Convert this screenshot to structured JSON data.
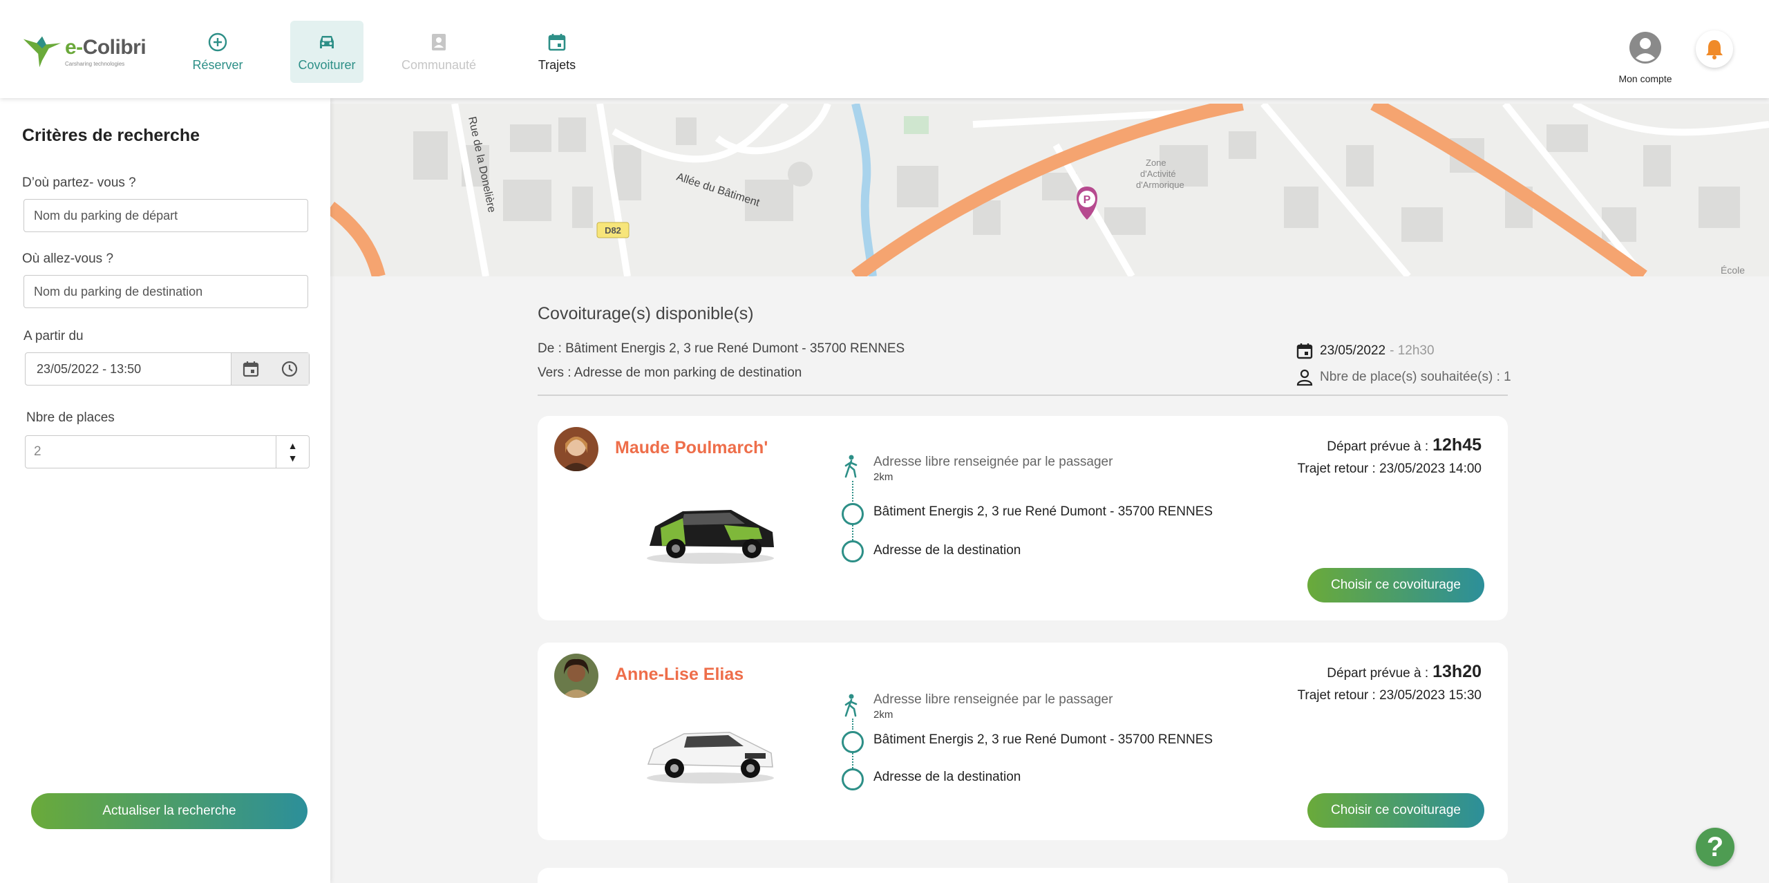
{
  "app": {
    "logo_name_prefix": "e-",
    "logo_name": "Colibri",
    "logo_tagline": "Carsharing technologies"
  },
  "nav": {
    "reserver": "Réserver",
    "covoiturer": "Covoiturer",
    "communaute": "Communauté",
    "trajets": "Trajets",
    "account": "Mon compte"
  },
  "sidebar": {
    "title": "Critères de recherche",
    "from_label": "D’où partez- vous ?",
    "from_placeholder": "Nom du parking de départ",
    "to_label": "Où allez-vous ?",
    "to_placeholder": "Nom du parking de destination",
    "date_label": "A partir du",
    "date_value": "23/05/2022  - 13:50",
    "seats_label": "Nbre de places",
    "seats_value": "2",
    "refresh_button": "Actualiser la recherche"
  },
  "map": {
    "street_1": "Rue de la Donelière",
    "street_2": "Allée du Bâtiment",
    "road_badge": "D82",
    "zone_label_1": "Zone",
    "zone_label_2": "d'Activité",
    "zone_label_3": "d'Armorique",
    "corner_label": "École",
    "parking_marker": "P"
  },
  "results": {
    "title": "Covoiturage(s) disponible(s)",
    "from": "De : Bâtiment Energis 2,  3 rue René Dumont - 35700 RENNES",
    "to": "Vers : Adresse de mon parking de destination",
    "date": "23/05/2022",
    "time": "- 12h30",
    "seats": "Nbre de place(s) souhaitée(s) : 1"
  },
  "rides": [
    {
      "driver": "Maude Poulmarch'",
      "pickup": "Adresse libre renseignée par le passager",
      "distance": "2km",
      "start": "Bâtiment Energis 2,  3 rue René Dumont - 35700 RENNES",
      "destination": "Adresse de la destination",
      "depart_label": "Départ prévue à :",
      "depart_time": "12h45",
      "return": "Trajet retour : 23/05/2023 14:00",
      "button": "Choisir ce covoiturage"
    },
    {
      "driver": "Anne-Lise Elias",
      "pickup": "Adresse libre renseignée par le passager",
      "distance": "2km",
      "start": "Bâtiment Energis 2,  3 rue René Dumont - 35700 RENNES",
      "destination": "Adresse de la destination",
      "depart_label": "Départ prévue à :",
      "depart_time": "13h20",
      "return": "Trajet retour : 23/05/2023 15:30",
      "button": "Choisir ce covoiturage"
    }
  ],
  "help": {
    "label": "?"
  },
  "colors": {
    "brand_teal": "#2d8f87",
    "brand_green": "#6aaa3a",
    "driver_name": "#ee6e4a",
    "road_orange": "#f5a470"
  }
}
